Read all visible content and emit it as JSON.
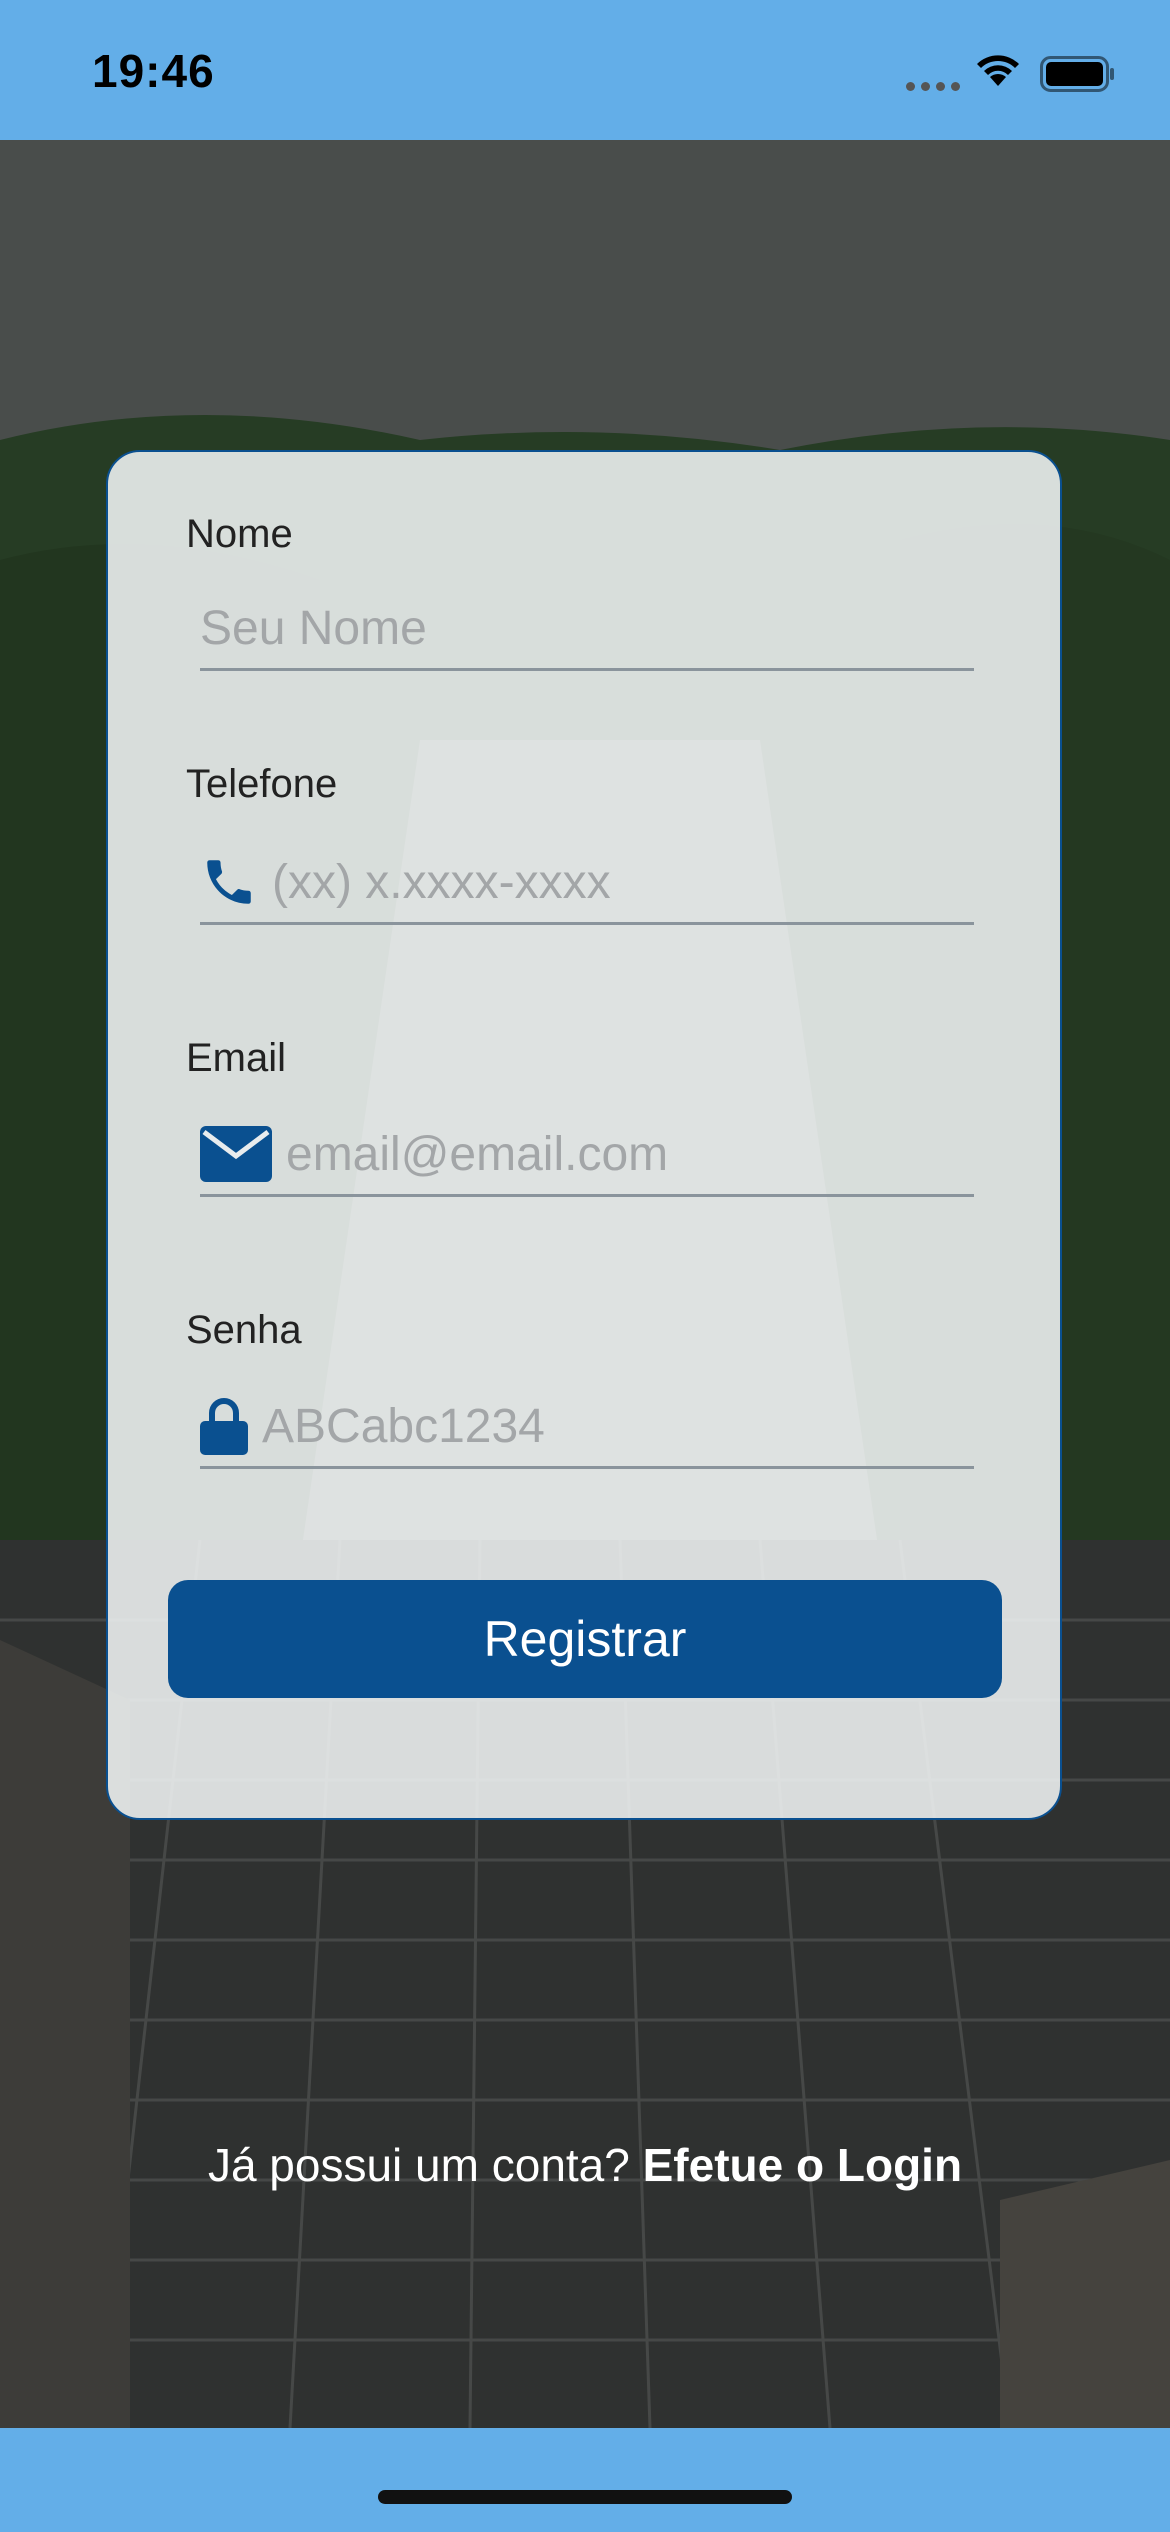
{
  "status_bar": {
    "time": "19:46"
  },
  "form": {
    "name": {
      "label": "Nome",
      "placeholder": "Seu Nome",
      "value": ""
    },
    "phone": {
      "label": "Telefone",
      "placeholder": "(xx) x.xxxx-xxxx",
      "value": "",
      "icon": "phone-icon"
    },
    "email": {
      "label": "Email",
      "placeholder": "email@email.com",
      "value": "",
      "icon": "envelope-icon"
    },
    "password": {
      "label": "Senha",
      "placeholder": "ABCabc1234",
      "value": "",
      "icon": "lock-icon"
    },
    "submit_label": "Registrar"
  },
  "footer": {
    "prompt": "Já possui um conta?",
    "login_link": "Efetue o Login"
  },
  "colors": {
    "accent": "#0a5090",
    "status_bar": "#63aee8",
    "card_border": "#0a5090"
  }
}
